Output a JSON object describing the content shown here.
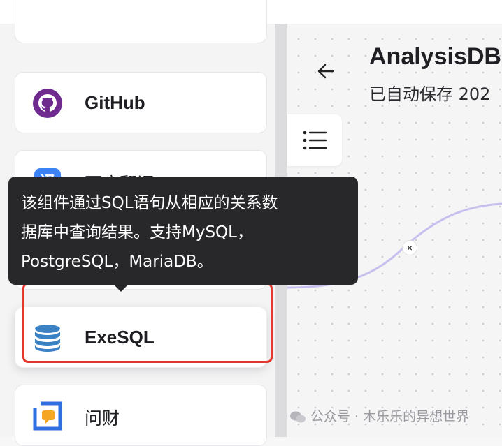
{
  "header": {
    "title": "AnalysisDB",
    "subtitle": "已自动保存 202",
    "back_icon": "arrow-left-icon",
    "menu_icon": "list-icon"
  },
  "sidebar": {
    "items": [
      {
        "label": "GitHub",
        "icon": "github-icon"
      },
      {
        "label": "百度翻译",
        "icon": "baidu-translate-icon"
      },
      {
        "label": "",
        "icon": "hidden-icon"
      },
      {
        "label": "ExeSQL",
        "icon": "database-icon"
      },
      {
        "label": "问财",
        "icon": "wencai-icon"
      }
    ]
  },
  "tooltip": {
    "line1": "该组件通过SQL语句从相应的关系数",
    "line2": "据库中查询结果。支持MySQL，",
    "line3": "PostgreSQL，MariaDB。"
  },
  "canvas": {
    "edge_close": "×"
  },
  "watermark": {
    "text": "公众号 · 木乐乐的异想世界"
  },
  "colors": {
    "github": "#6e2a8f",
    "baidu": "#3b82f6",
    "database": "#3b82c4",
    "highlight": "#e4382f",
    "tooltip_bg": "#28282b",
    "edge": "#c6c0ee"
  }
}
